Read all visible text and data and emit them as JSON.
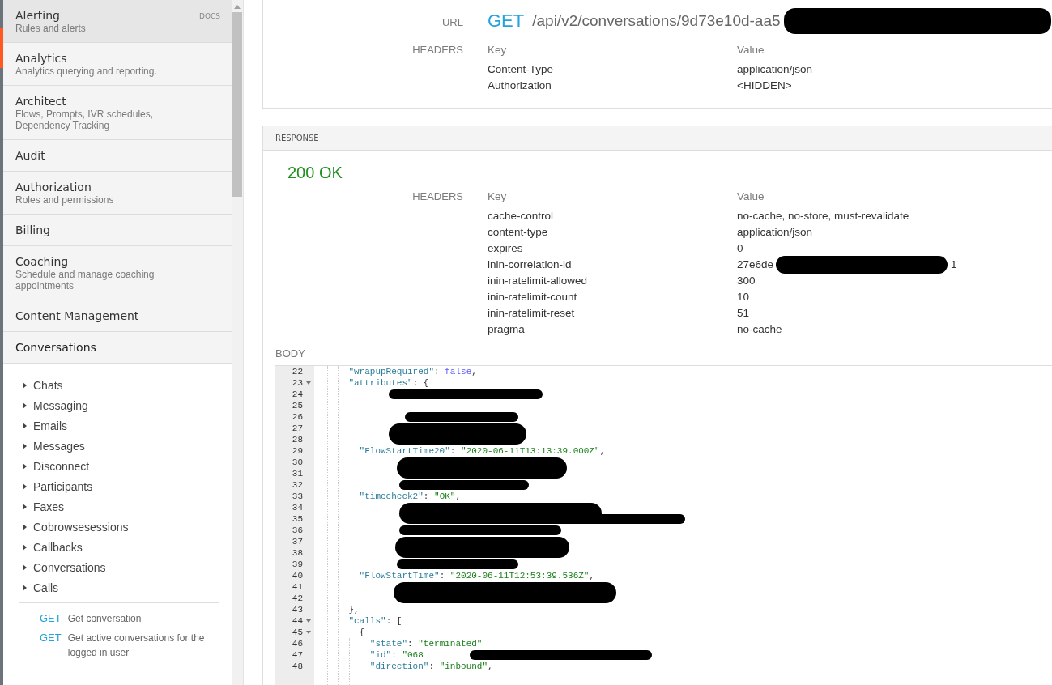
{
  "sidebar": {
    "docs_label": "DOCS",
    "categories": [
      {
        "title": "Alerting",
        "subtitle": "Rules and alerts",
        "selected": true
      },
      {
        "title": "Analytics",
        "subtitle": "Analytics querying and reporting.",
        "selected": false
      },
      {
        "title": "Architect",
        "subtitle": "Flows, Prompts, IVR schedules, Dependency Tracking",
        "selected": false
      },
      {
        "title": "Audit",
        "selected": false
      },
      {
        "title": "Authorization",
        "subtitle": "Roles and permissions",
        "selected": false
      },
      {
        "title": "Billing",
        "selected": false
      },
      {
        "title": "Coaching",
        "subtitle": "Schedule and manage coaching appointments",
        "selected": false
      },
      {
        "title": "Content Management",
        "selected": false
      },
      {
        "title": "Conversations",
        "selected": false,
        "expanded": true,
        "children": [
          {
            "label": "Chats",
            "expanded": false
          },
          {
            "label": "Messaging",
            "expanded": false
          },
          {
            "label": "Emails",
            "expanded": false
          },
          {
            "label": "Messages",
            "expanded": false
          },
          {
            "label": "Disconnect",
            "expanded": false
          },
          {
            "label": "Participants",
            "expanded": false
          },
          {
            "label": "Faxes",
            "expanded": false
          },
          {
            "label": "Cobrowsesessions",
            "expanded": false
          },
          {
            "label": "Callbacks",
            "expanded": false
          },
          {
            "label": "Conversations",
            "expanded": false
          },
          {
            "label": "Calls",
            "expanded": false
          }
        ],
        "endpoints": [
          {
            "method": "GET",
            "label": "Get conversation"
          },
          {
            "method": "GET",
            "label": "Get active conversations for the logged in user"
          }
        ]
      }
    ]
  },
  "request": {
    "url_label": "URL",
    "method": "GET",
    "url": "/api/v2/conversations/9d73e10d-aa5",
    "headers_label": "HEADERS",
    "key_heading": "Key",
    "value_heading": "Value",
    "headers": [
      {
        "key": "Content-Type",
        "value": "application/json"
      },
      {
        "key": "Authorization",
        "value": "<HIDDEN>"
      }
    ]
  },
  "response": {
    "section_title": "RESPONSE",
    "status": "200 OK",
    "headers_label": "HEADERS",
    "key_heading": "Key",
    "value_heading": "Value",
    "headers": [
      {
        "key": "cache-control",
        "value": "no-cache, no-store, must-revalidate"
      },
      {
        "key": "content-type",
        "value": "application/json"
      },
      {
        "key": "expires",
        "value": "0"
      },
      {
        "key": "inin-correlation-id",
        "value": "27e6de",
        "value_end": "1"
      },
      {
        "key": "inin-ratelimit-allowed",
        "value": "300"
      },
      {
        "key": "inin-ratelimit-count",
        "value": "10"
      },
      {
        "key": "inin-ratelimit-reset",
        "value": "51"
      },
      {
        "key": "pragma",
        "value": "no-cache"
      }
    ],
    "body_label": "BODY",
    "code_lines": [
      {
        "number": "22",
        "fold": false,
        "tokens": [
          {
            "kind": "key",
            "text": "    \"wrapupRequired\""
          },
          {
            "kind": "punct",
            "text": ": "
          },
          {
            "kind": "bool",
            "text": "false"
          },
          {
            "kind": "punct",
            "text": ","
          }
        ]
      },
      {
        "number": "23",
        "fold": true,
        "tokens": [
          {
            "kind": "key",
            "text": "    \"attributes\""
          },
          {
            "kind": "punct",
            "text": ": {"
          }
        ]
      },
      {
        "number": "24",
        "fold": false
      },
      {
        "number": "25",
        "fold": false
      },
      {
        "number": "26",
        "fold": false
      },
      {
        "number": "27",
        "fold": false
      },
      {
        "number": "28",
        "fold": false
      },
      {
        "number": "29",
        "fold": false,
        "tokens": [
          {
            "kind": "key",
            "text": "      \"FlowStartTime20\""
          },
          {
            "kind": "punct",
            "text": ": "
          },
          {
            "kind": "str",
            "text": "\"2020-06-11T13:13:39.000Z\""
          },
          {
            "kind": "punct",
            "text": ","
          }
        ]
      },
      {
        "number": "30",
        "fold": false
      },
      {
        "number": "31",
        "fold": false
      },
      {
        "number": "32",
        "fold": false
      },
      {
        "number": "33",
        "fold": false,
        "tokens": [
          {
            "kind": "key",
            "text": "      \"timecheck2\""
          },
          {
            "kind": "punct",
            "text": ": "
          },
          {
            "kind": "str",
            "text": "\"OK\""
          },
          {
            "kind": "punct",
            "text": ","
          }
        ]
      },
      {
        "number": "34",
        "fold": false
      },
      {
        "number": "35",
        "fold": false
      },
      {
        "number": "36",
        "fold": false
      },
      {
        "number": "37",
        "fold": false
      },
      {
        "number": "38",
        "fold": false
      },
      {
        "number": "39",
        "fold": false
      },
      {
        "number": "40",
        "fold": false,
        "tokens": [
          {
            "kind": "key",
            "text": "      \"FlowStartTime\""
          },
          {
            "kind": "punct",
            "text": ": "
          },
          {
            "kind": "str",
            "text": "\"2020-06-11T12:53:39.536Z\""
          },
          {
            "kind": "punct",
            "text": ","
          }
        ]
      },
      {
        "number": "41",
        "fold": false
      },
      {
        "number": "42",
        "fold": false
      },
      {
        "number": "43",
        "fold": false,
        "tokens": [
          {
            "kind": "punct",
            "text": "    },"
          }
        ]
      },
      {
        "number": "44",
        "fold": true,
        "tokens": [
          {
            "kind": "key",
            "text": "    \"calls\""
          },
          {
            "kind": "punct",
            "text": ": ["
          }
        ]
      },
      {
        "number": "45",
        "fold": true,
        "tokens": [
          {
            "kind": "punct",
            "text": "      {"
          }
        ]
      },
      {
        "number": "46",
        "fold": false,
        "tokens": [
          {
            "kind": "key",
            "text": "        \"state\""
          },
          {
            "kind": "punct",
            "text": ": "
          },
          {
            "kind": "str",
            "text": "\"terminated\""
          }
        ]
      },
      {
        "number": "47",
        "fold": false,
        "tokens": [
          {
            "kind": "key",
            "text": "        \"id\""
          },
          {
            "kind": "punct",
            "text": ": "
          },
          {
            "kind": "str",
            "text": "\"068"
          }
        ]
      },
      {
        "number": "48",
        "fold": false,
        "tokens": [
          {
            "kind": "key",
            "text": "        \"direction\""
          },
          {
            "kind": "punct",
            "text": ": "
          },
          {
            "kind": "str",
            "text": "\"inbound\""
          },
          {
            "kind": "punct",
            "text": ","
          }
        ]
      }
    ]
  }
}
